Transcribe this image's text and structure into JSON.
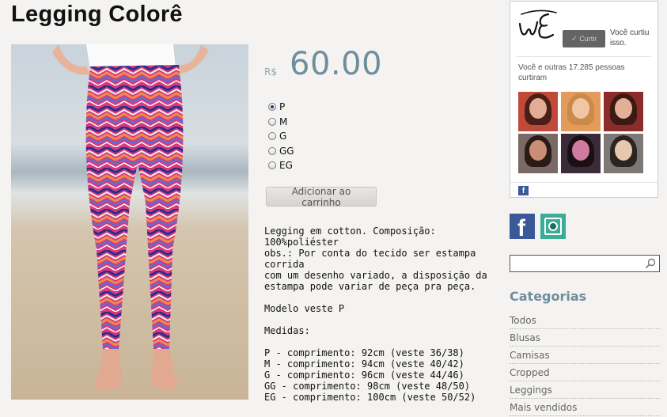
{
  "product": {
    "title": "Legging Colorê",
    "currency": "R$",
    "price": "60.00",
    "sizes": [
      {
        "label": "P",
        "selected": true
      },
      {
        "label": "M",
        "selected": false
      },
      {
        "label": "G",
        "selected": false
      },
      {
        "label": "GG",
        "selected": false
      },
      {
        "label": "EG",
        "selected": false
      }
    ],
    "add_to_cart_label": "Adicionar ao carrinho",
    "description": "Legging em cotton. Composição:\n100%poliéster\nobs.: Por conta do tecido ser estampa corrida\ncom um desenho variado, a disposição da\nestampa pode variar de peça pra peça.\n\nModelo veste P\n\nMedidas:\n\nP - comprimento: 92cm (veste 36/38)\nM - comprimento: 94cm (veste 40/42)\nG - comprimento: 96cm (veste 44/46)\nGG - comprimento: 98cm (veste 48/50)\nEG - comprimento: 100cm (veste 50/52)"
  },
  "facebook_box": {
    "like_label": "Curtir",
    "you_liked": "Você curtiu isso.",
    "count_text": "Você e outras 17.285 pessoas curtiram",
    "fb_glyph": "f"
  },
  "social": {
    "facebook_glyph": "f"
  },
  "search": {
    "placeholder": "",
    "value": ""
  },
  "categories": {
    "title": "Categorias",
    "items": [
      "Todos",
      "Blusas",
      "Camisas",
      "Cropped",
      "Leggings",
      "Mais vendidos"
    ]
  },
  "colors": {
    "accent": "#6f8e9c",
    "facebook": "#3b5998",
    "instagram": "#3dac96"
  },
  "icons": [
    "radio-icon",
    "check-icon",
    "facebook-icon",
    "instagram-icon",
    "search-icon"
  ]
}
